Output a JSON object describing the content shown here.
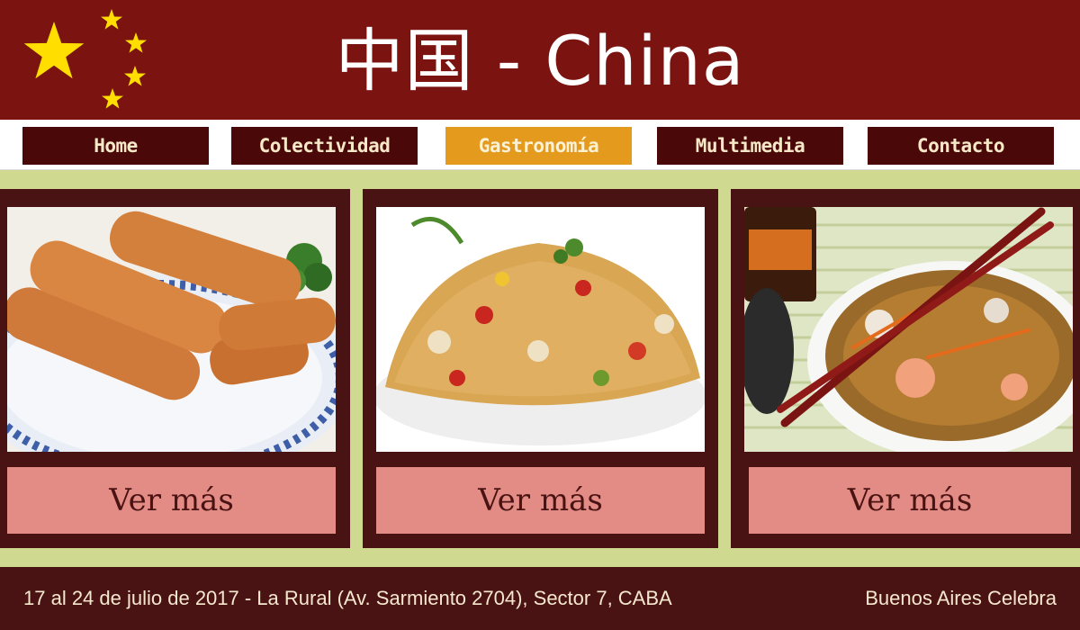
{
  "header": {
    "title": "中国 - China",
    "colors": {
      "background": "#7b1411",
      "stars": "#ffde00"
    }
  },
  "nav": {
    "items": [
      {
        "label": "Home",
        "active": false
      },
      {
        "label": "Colectividad",
        "active": false
      },
      {
        "label": "Gastronomía",
        "active": true
      },
      {
        "label": "Multimedia",
        "active": false
      },
      {
        "label": "Contacto",
        "active": false
      }
    ],
    "colors": {
      "item_bg": "#4a0808",
      "active_bg": "#e39a1d"
    }
  },
  "cards": [
    {
      "image": "spring-rolls-photo",
      "button_label": "Ver más"
    },
    {
      "image": "fried-rice-photo",
      "button_label": "Ver más"
    },
    {
      "image": "noodles-chopsticks-photo",
      "button_label": "Ver más"
    }
  ],
  "footer": {
    "address": "17 al 24 de julio de 2017 - La Rural (Av. Sarmiento 2704), Sector 7, CABA",
    "right_text": "Buenos Aires Celebra"
  }
}
